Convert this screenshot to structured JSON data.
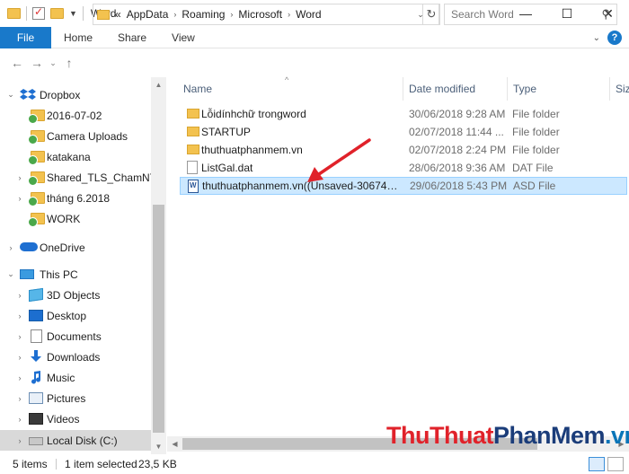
{
  "window": {
    "title": "Word",
    "controls": [
      "—",
      "☐",
      "✕"
    ]
  },
  "ribbon": {
    "tabs": [
      "File",
      "Home",
      "Share",
      "View"
    ]
  },
  "address": {
    "breadcrumbs": [
      "«",
      "AppData",
      "Roaming",
      "Microsoft",
      "Word"
    ],
    "search_placeholder": "Search Word"
  },
  "nav": {
    "items": [
      {
        "label": "Dropbox",
        "icon": "dropbox-icon"
      },
      {
        "label": "2016-07-02",
        "icon": "folder-icon"
      },
      {
        "label": "Camera Uploads",
        "icon": "folder-icon"
      },
      {
        "label": "katakana",
        "icon": "folder-icon"
      },
      {
        "label": "Shared_TLS_ChamNT",
        "icon": "folder-icon"
      },
      {
        "label": "tháng 6.2018",
        "icon": "folder-icon"
      },
      {
        "label": "WORK",
        "icon": "folder-icon"
      },
      {
        "label": "OneDrive",
        "icon": "cloud-icon"
      },
      {
        "label": "This PC",
        "icon": "computer-icon"
      },
      {
        "label": "3D Objects",
        "icon": "cube-icon"
      },
      {
        "label": "Desktop",
        "icon": "desktop-icon"
      },
      {
        "label": "Documents",
        "icon": "documents-icon"
      },
      {
        "label": "Downloads",
        "icon": "download-icon"
      },
      {
        "label": "Music",
        "icon": "music-icon"
      },
      {
        "label": "Pictures",
        "icon": "pictures-icon"
      },
      {
        "label": "Videos",
        "icon": "videos-icon"
      },
      {
        "label": "Local Disk (C:)",
        "icon": "disk-icon"
      }
    ]
  },
  "list": {
    "columns": [
      "Name",
      "Date modified",
      "Type",
      "Siz"
    ],
    "rows": [
      {
        "name": "Lỗidínhchữ trongword",
        "date": "30/06/2018 9:28 AM",
        "type": "File folder",
        "icon": "folder-icon"
      },
      {
        "name": "STARTUP",
        "date": "02/07/2018 11:44 ...",
        "type": "File folder",
        "icon": "folder-icon"
      },
      {
        "name": "thuthuatphanmem.vn",
        "date": "02/07/2018 2:24 PM",
        "type": "File folder",
        "icon": "folder-icon"
      },
      {
        "name": "ListGal.dat",
        "date": "28/06/2018 9:36 AM",
        "type": "DAT File",
        "icon": "file-icon"
      },
      {
        "name": "thuthuatphanmem.vn((Unsaved-3067489...",
        "date": "29/06/2018 5:43 PM",
        "type": "ASD File",
        "icon": "word-file-icon",
        "selected": true
      }
    ]
  },
  "status": {
    "items_count": "5 items",
    "selected": "1 item selected",
    "size": "23,5 KB"
  },
  "watermark": {
    "part1": "Thu",
    "part2": "Thuat",
    "part3": "PhanMem",
    "part4": ".vn"
  },
  "colors": {
    "accent": "#1979ca",
    "selection": "#cce8ff",
    "annotation_arrow": "#e0222a"
  }
}
